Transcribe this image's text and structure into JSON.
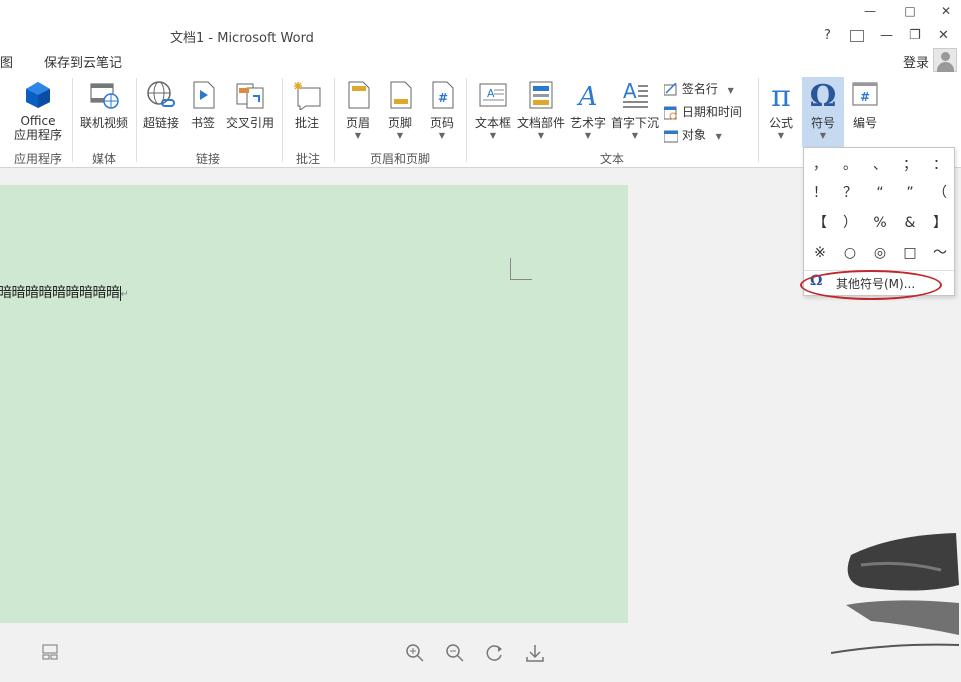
{
  "window": {
    "title": "文档1 - Microsoft Word",
    "controls": {
      "minimize": "—",
      "maximize": "□",
      "close": "✕",
      "help": "?",
      "ribbon_options": "⊼",
      "min2": "—",
      "restore": "❐",
      "close2": "✕"
    }
  },
  "menubar": {
    "items": [
      "图",
      "保存到云笔记"
    ],
    "login": "登录"
  },
  "ribbon": {
    "groups": [
      {
        "label": "应用程序"
      },
      {
        "label": "媒体"
      },
      {
        "label": "链接"
      },
      {
        "label": "批注"
      },
      {
        "label": "页眉和页脚"
      },
      {
        "label": "文本"
      }
    ],
    "buttons": {
      "office_apps": "Office\n应用程序",
      "office_line1": "Office",
      "office_line2": "应用程序",
      "online_video": "联机视频",
      "hyperlink": "超链接",
      "bookmark": "书签",
      "cross_ref": "交叉引用",
      "comment": "批注",
      "header": "页眉",
      "footer": "页脚",
      "page_number": "页码",
      "text_box": "文本框",
      "quick_parts": "文档部件",
      "wordart": "艺术字",
      "drop_cap": "首字下沉",
      "signature_line": "签名行",
      "date_time": "日期和时间",
      "object": "对象",
      "equation": "公式",
      "symbol": "符号",
      "numbering": "编号"
    }
  },
  "document": {
    "text": "暗暗暗暗暗暗暗暗暗",
    "para_mark": "↵"
  },
  "symbol_dropdown": {
    "symbols": [
      "，",
      "。",
      "、",
      "；",
      "：",
      "！",
      "？",
      "“",
      "”",
      "（",
      "【",
      "）",
      "%",
      "&",
      "】",
      "※",
      "○",
      "◎",
      "□",
      "～"
    ],
    "more_label": "其他符号(M)..."
  },
  "colors": {
    "page_bg": "#cfe8d2",
    "accent": "#2b579a",
    "annotation": "#c0282d",
    "active_button": "#c5daf1"
  }
}
